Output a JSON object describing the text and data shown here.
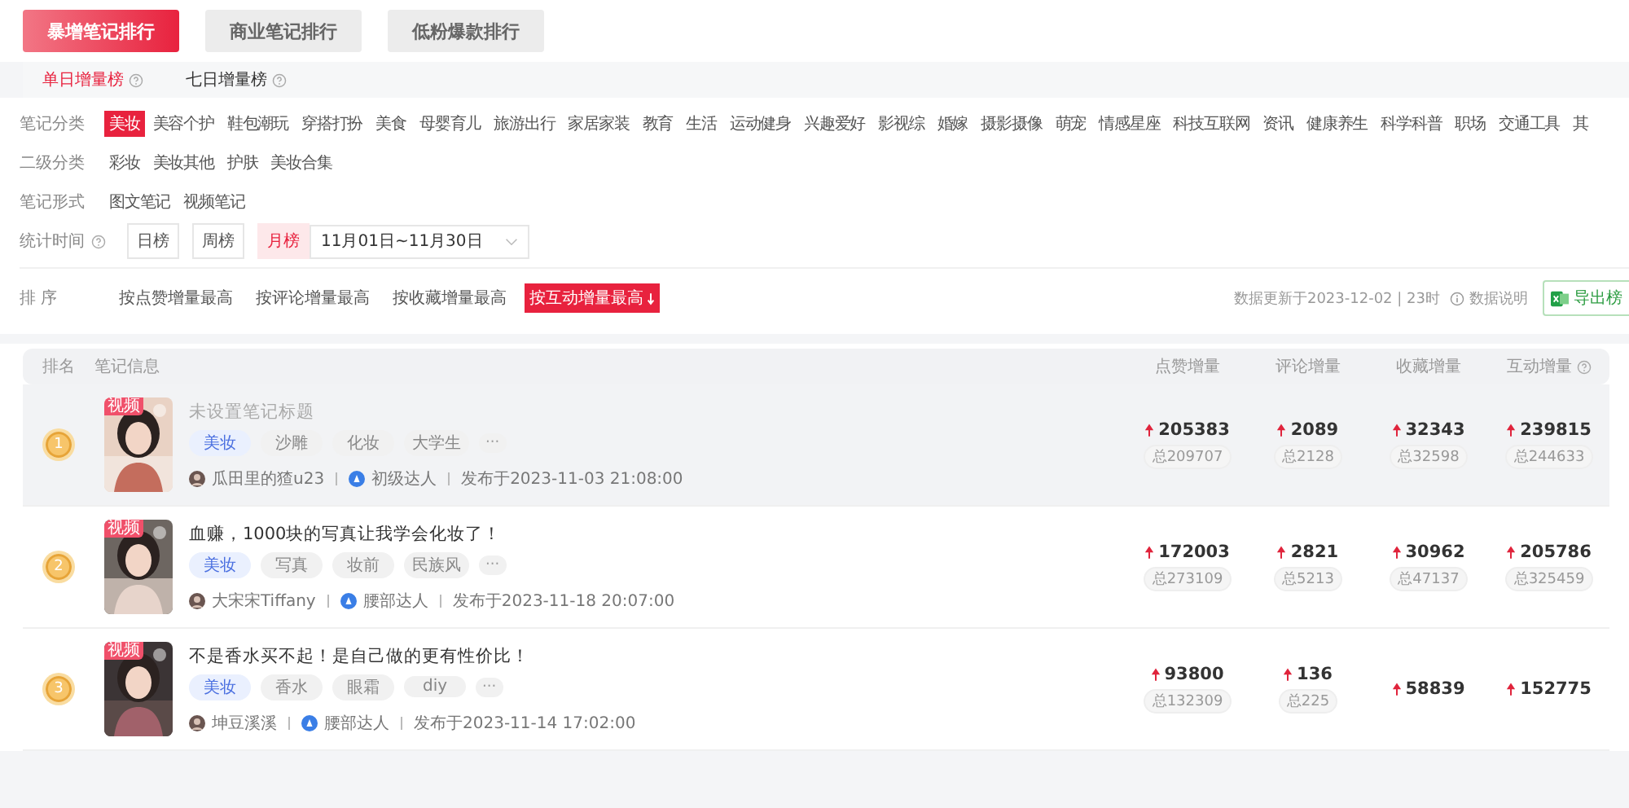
{
  "main_tabs": [
    {
      "label": "暴增笔记排行",
      "selected": true
    },
    {
      "label": "商业笔记排行",
      "selected": false
    },
    {
      "label": "低粉爆款排行",
      "selected": false
    }
  ],
  "sub_tabs": [
    {
      "label": "单日增量榜",
      "selected": true
    },
    {
      "label": "七日增量榜",
      "selected": false
    }
  ],
  "filters": [
    {
      "label": "笔记分类",
      "options": [
        {
          "label": "美妆",
          "selected": true
        },
        {
          "label": "美容个护",
          "selected": false
        },
        {
          "label": "鞋包潮玩",
          "selected": false
        },
        {
          "label": "穿搭打扮",
          "selected": false
        },
        {
          "label": "美食",
          "selected": false
        },
        {
          "label": "母婴育儿",
          "selected": false
        },
        {
          "label": "旅游出行",
          "selected": false
        },
        {
          "label": "家居家装",
          "selected": false
        },
        {
          "label": "教育",
          "selected": false
        },
        {
          "label": "生活",
          "selected": false
        },
        {
          "label": "运动健身",
          "selected": false
        },
        {
          "label": "兴趣爱好",
          "selected": false
        },
        {
          "label": "影视综",
          "selected": false
        },
        {
          "label": "婚嫁",
          "selected": false
        },
        {
          "label": "摄影摄像",
          "selected": false
        },
        {
          "label": "萌宠",
          "selected": false
        },
        {
          "label": "情感星座",
          "selected": false
        },
        {
          "label": "科技互联网",
          "selected": false
        },
        {
          "label": "资讯",
          "selected": false
        },
        {
          "label": "健康养生",
          "selected": false
        },
        {
          "label": "科学科普",
          "selected": false
        },
        {
          "label": "职场",
          "selected": false
        },
        {
          "label": "交通工具",
          "selected": false
        },
        {
          "label": "其",
          "selected": false
        }
      ]
    },
    {
      "label": "二级分类",
      "options": [
        {
          "label": "彩妆",
          "selected": false
        },
        {
          "label": "美妆其他",
          "selected": false
        },
        {
          "label": "护肤",
          "selected": false
        },
        {
          "label": "美妆合集",
          "selected": false
        }
      ]
    },
    {
      "label": "笔记形式",
      "options": [
        {
          "label": "图文笔记",
          "selected": false
        },
        {
          "label": "视频笔记",
          "selected": false
        }
      ]
    }
  ],
  "stat_time": {
    "label": "统计时间",
    "options": [
      {
        "label": "日榜",
        "selected": false
      },
      {
        "label": "周榜",
        "selected": false
      },
      {
        "label": "月榜",
        "selected": true
      }
    ],
    "date_range": "11月01日~11月30日"
  },
  "sort": {
    "label": "排 序",
    "options": [
      {
        "label": "按点赞增量最高",
        "selected": false
      },
      {
        "label": "按评论增量最高",
        "selected": false
      },
      {
        "label": "按收藏增量最高",
        "selected": false
      },
      {
        "label": "按互动增量最高",
        "selected": true
      }
    ],
    "update_info": "数据更新于2023-12-02 | 23时",
    "data_note": "数据说明",
    "export": "导出榜"
  },
  "table": {
    "columns": [
      {
        "label": "排名",
        "help": false
      },
      {
        "label": "笔记信息",
        "help": false
      },
      {
        "label": "点赞增量",
        "help": false
      },
      {
        "label": "评论增量",
        "help": false
      },
      {
        "label": "收藏增量",
        "help": false
      },
      {
        "label": "互动增量",
        "help": true
      }
    ],
    "rows": [
      {
        "rank": "1",
        "highlighted": true,
        "badge": "视频",
        "title": "未设置笔记标题",
        "untitled": true,
        "tags": [
          {
            "label": "美妆",
            "kind": "category"
          },
          {
            "label": "沙雕",
            "kind": "topic"
          },
          {
            "label": "化妆",
            "kind": "topic"
          },
          {
            "label": "大学生",
            "kind": "topic"
          }
        ],
        "more": "···",
        "author": "瓜田里的猹u23",
        "level": "初级达人",
        "published": "发布于2023-11-03 21:08:00",
        "metrics": [
          {
            "value": "205383",
            "total": "总209707"
          },
          {
            "value": "2089",
            "total": "总2128"
          },
          {
            "value": "32343",
            "total": "总32598"
          },
          {
            "value": "239815",
            "total": "总244633"
          }
        ]
      },
      {
        "rank": "2",
        "highlighted": false,
        "badge": "视频",
        "title": "血赚，1000块的写真让我学会化妆了！",
        "untitled": false,
        "tags": [
          {
            "label": "美妆",
            "kind": "category"
          },
          {
            "label": "写真",
            "kind": "topic"
          },
          {
            "label": "妆前",
            "kind": "topic"
          },
          {
            "label": "民族风",
            "kind": "topic"
          }
        ],
        "more": "···",
        "author": "大宋宋Tiffany",
        "level": "腰部达人",
        "published": "发布于2023-11-18 20:07:00",
        "metrics": [
          {
            "value": "172003",
            "total": "总273109"
          },
          {
            "value": "2821",
            "total": "总5213"
          },
          {
            "value": "30962",
            "total": "总47137"
          },
          {
            "value": "205786",
            "total": "总325459"
          }
        ]
      },
      {
        "rank": "3",
        "highlighted": false,
        "badge": "视频",
        "title": "不是香水买不起！是自己做的更有性价比！",
        "untitled": false,
        "tags": [
          {
            "label": "美妆",
            "kind": "category"
          },
          {
            "label": "香水",
            "kind": "topic"
          },
          {
            "label": "眼霜",
            "kind": "topic"
          },
          {
            "label": "diy",
            "kind": "topic"
          }
        ],
        "more": "···",
        "author": "坤豆溪溪",
        "level": "腰部达人",
        "published": "发布于2023-11-14 17:02:00",
        "metrics": [
          {
            "value": "93800",
            "total": "总132309"
          },
          {
            "value": "136",
            "total": "总225"
          },
          {
            "value": "58839"
          },
          {
            "value": "152775"
          }
        ]
      }
    ]
  }
}
